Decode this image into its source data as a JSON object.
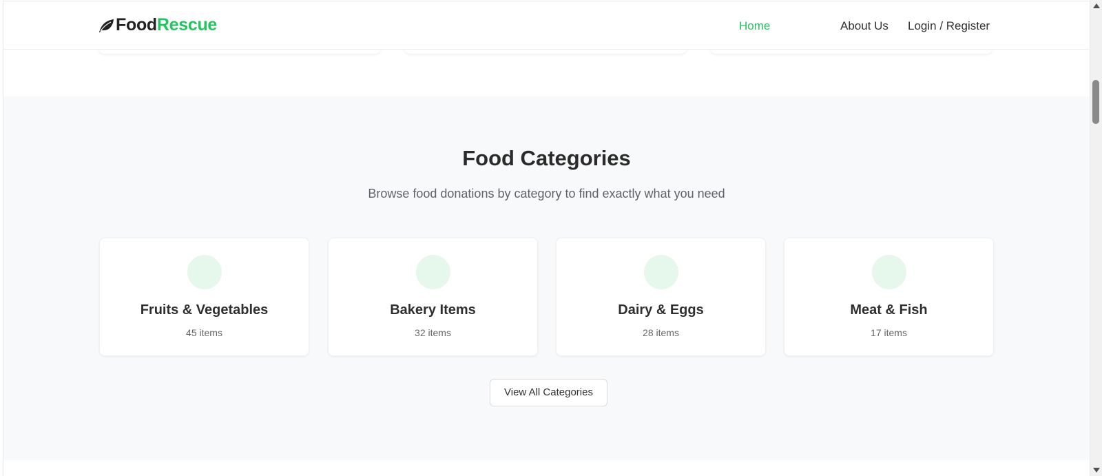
{
  "header": {
    "logo": {
      "part1": "Food",
      "part2": "Rescue",
      "icon": "leaf-icon"
    },
    "nav": {
      "home": "Home",
      "about": "About Us",
      "login": "Login / Register"
    }
  },
  "categories": {
    "title": "Food Categories",
    "subtitle": "Browse food donations by category to find exactly what you need",
    "items": [
      {
        "name": "Fruits & Vegetables",
        "count": "45 items"
      },
      {
        "name": "Bakery Items",
        "count": "32 items"
      },
      {
        "name": "Dairy & Eggs",
        "count": "28 items"
      },
      {
        "name": "Meat & Fish",
        "count": "17 items"
      }
    ],
    "view_all": "View All Categories"
  },
  "colors": {
    "accent": "#22c55e",
    "icon_bg": "#e6f8ec",
    "section_bg": "#f8f9fa",
    "text": "#2f2f2f"
  }
}
